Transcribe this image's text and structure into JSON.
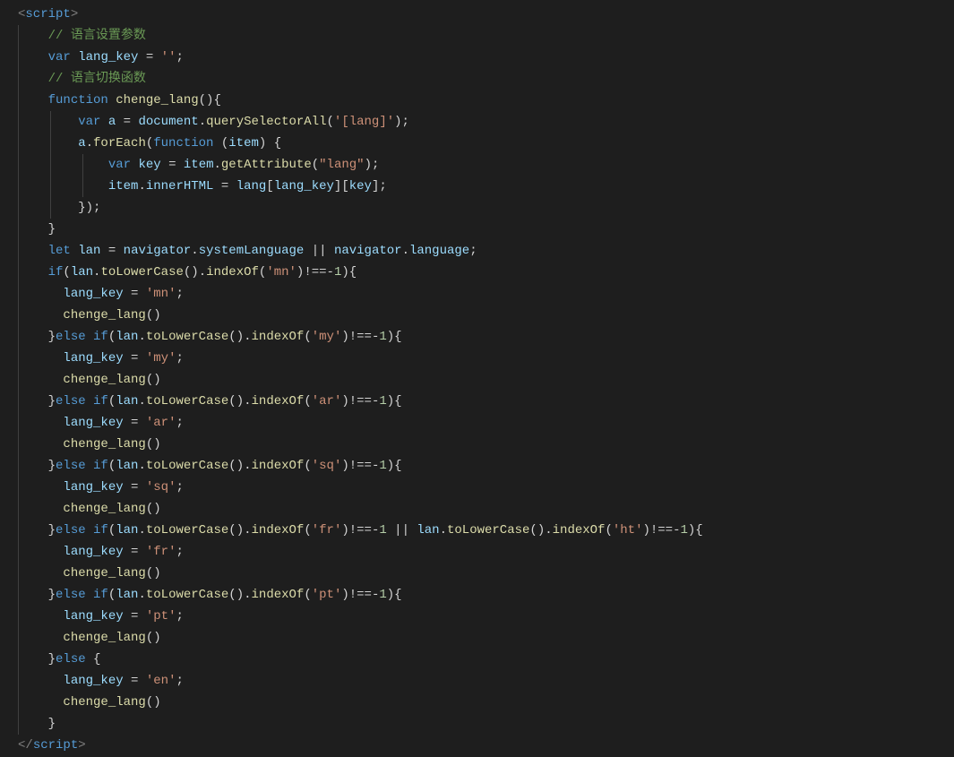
{
  "code": {
    "l1_tag_open": "<",
    "l1_tag_name": "script",
    "l1_tag_close": ">",
    "l2_comment": "// 语言设置参数",
    "l3_kw_var": "var",
    "l3_id": "lang_key",
    "l3_eq": " = ",
    "l3_str": "''",
    "l3_semi": ";",
    "l4_comment": "// 语言切换函数",
    "l5_kw_fn": "function",
    "l5_fn": "chenge_lang",
    "l5_paren": "(){",
    "l6_kw_var": "var",
    "l6_id_a": "a",
    "l6_eq": " = ",
    "l6_obj": "document",
    "l6_dot": ".",
    "l6_fn": "querySelectorAll",
    "l6_arg": "'[lang]'",
    "l6_tail": ");",
    "l7_id_a": "a",
    "l7_dot": ".",
    "l7_fn": "forEach",
    "l7_kw_fn": "function",
    "l7_param": "item",
    "l7_tail": ") {",
    "l8_kw_var": "var",
    "l8_id": "key",
    "l8_eq": " = ",
    "l8_obj": "item",
    "l8_dot": ".",
    "l8_fn": "getAttribute",
    "l8_arg": "\"lang\"",
    "l8_tail": ");",
    "l9_obj": "item",
    "l9_dot1": ".",
    "l9_prop": "innerHTML",
    "l9_eq": " = ",
    "l9_lang": "lang",
    "l9_br1": "[",
    "l9_lk": "lang_key",
    "l9_br2": "][",
    "l9_key": "key",
    "l9_br3": "];",
    "l10_close": "});",
    "l11_close": "}",
    "l12_kw_let": "let",
    "l12_id": "lan",
    "l12_eq": " = ",
    "l12_nav": "navigator",
    "l12_dot": ".",
    "l12_sys": "systemLanguage",
    "l12_or": " || ",
    "l12_nav2": "navigator",
    "l12_dot2": ".",
    "l12_lang": "language",
    "l12_semi": ";",
    "if_kw": "if",
    "else_kw": "else",
    "l13_lan": "lan",
    "l13_tolc": "toLowerCase",
    "l13_indexof": "indexOf",
    "l13_str_mn": "'mn'",
    "l13_neq": ")!==-",
    "l13_num1": "1",
    "l13_tail": "){",
    "assign_lang_key": "lang_key",
    "assign_eq": " = ",
    "str_mn": "'mn'",
    "str_my": "'my'",
    "str_ar": "'ar'",
    "str_sq": "'sq'",
    "str_fr": "'fr'",
    "str_ht": "'ht'",
    "str_pt": "'pt'",
    "str_en": "'en'",
    "semi": ";",
    "call_chenge": "chenge_lang",
    "call_tail": "()",
    "close_brace": "}",
    "close_tag_open": "</",
    "close_tag_name": "script",
    "close_tag_close": ">",
    "dot": ".",
    "open_paren": "(",
    "close_paren": ")",
    "or": " || ",
    "indent1": "    ",
    "indent2": "        ",
    "indent3": "            ",
    "indent_body": "      "
  }
}
